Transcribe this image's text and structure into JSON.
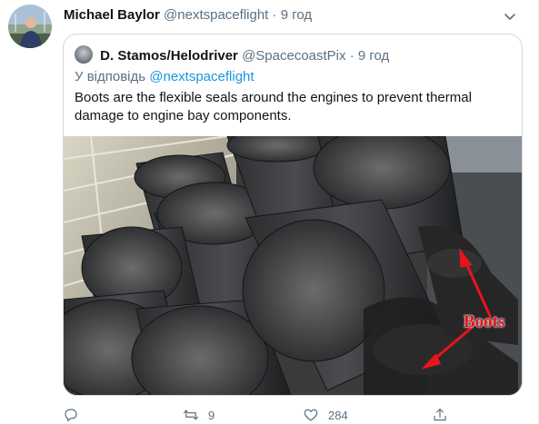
{
  "tweet": {
    "author_name": "Michael Baylor",
    "author_handle": "@nextspaceflight",
    "separator": "·",
    "time": "9 год"
  },
  "quoted": {
    "author_name": "D. Stamos/Helodriver",
    "author_handle": "@SpacecoastPix",
    "separator": "·",
    "time": "9 год",
    "reply_prefix": "У відповідь",
    "reply_mention": "@nextspaceflight",
    "text": "Boots are the flexible seals around the engines to prevent thermal damage to engine bay components.",
    "image_annotation": "Boots"
  },
  "actions": {
    "reply_count": "",
    "retweet_count": "9",
    "like_count": "284"
  },
  "icons": [
    "caret-down-icon",
    "reply-icon",
    "retweet-icon",
    "like-icon",
    "share-icon"
  ],
  "colors": {
    "muted": "#5b7083",
    "link": "#1b95e0",
    "annotation": "#e8141b"
  }
}
